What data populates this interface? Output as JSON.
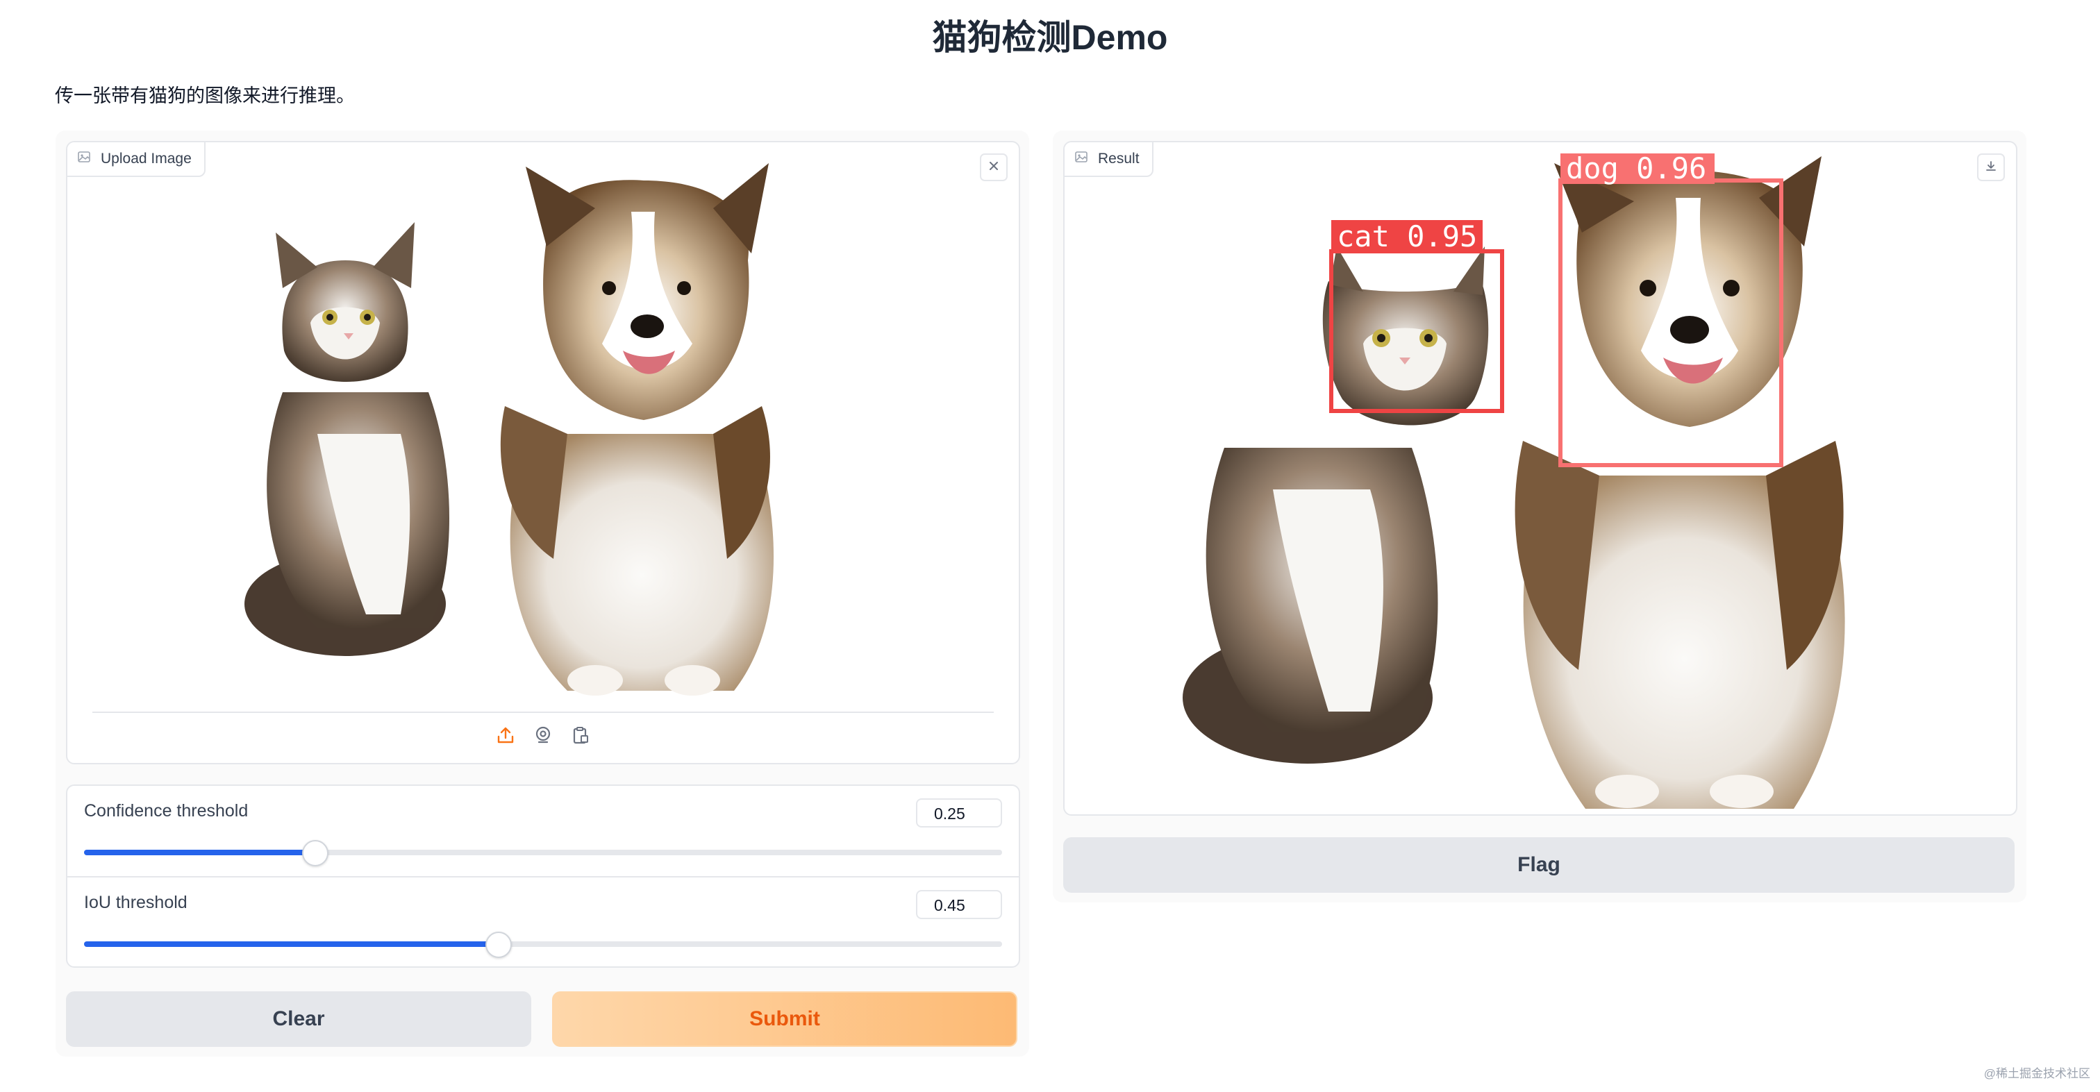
{
  "page": {
    "title": "猫狗检测Demo",
    "description": "传一张带有猫狗的图像来进行推理。"
  },
  "input_panel": {
    "upload_label": "Upload Image",
    "confidence": {
      "label": "Confidence threshold",
      "value": "0.25",
      "fraction": 0.25
    },
    "iou": {
      "label": "IoU threshold",
      "value": "0.45",
      "fraction": 0.45
    },
    "clear_label": "Clear",
    "submit_label": "Submit",
    "icons": [
      "image-icon",
      "close-icon",
      "upload-icon",
      "webcam-icon",
      "clipboard-icon"
    ]
  },
  "output_panel": {
    "result_label": "Result",
    "flag_label": "Flag",
    "detections": [
      {
        "label": "cat 0.95",
        "color": "#ef4444"
      },
      {
        "label": "dog 0.96",
        "color": "#f87171"
      }
    ],
    "icons": [
      "image-icon",
      "download-icon"
    ]
  },
  "colors": {
    "accent": "#2563eb",
    "submit_text": "#ea580c",
    "submit_bg": "#fdba74"
  },
  "watermark": "@稀土掘金技术社区"
}
